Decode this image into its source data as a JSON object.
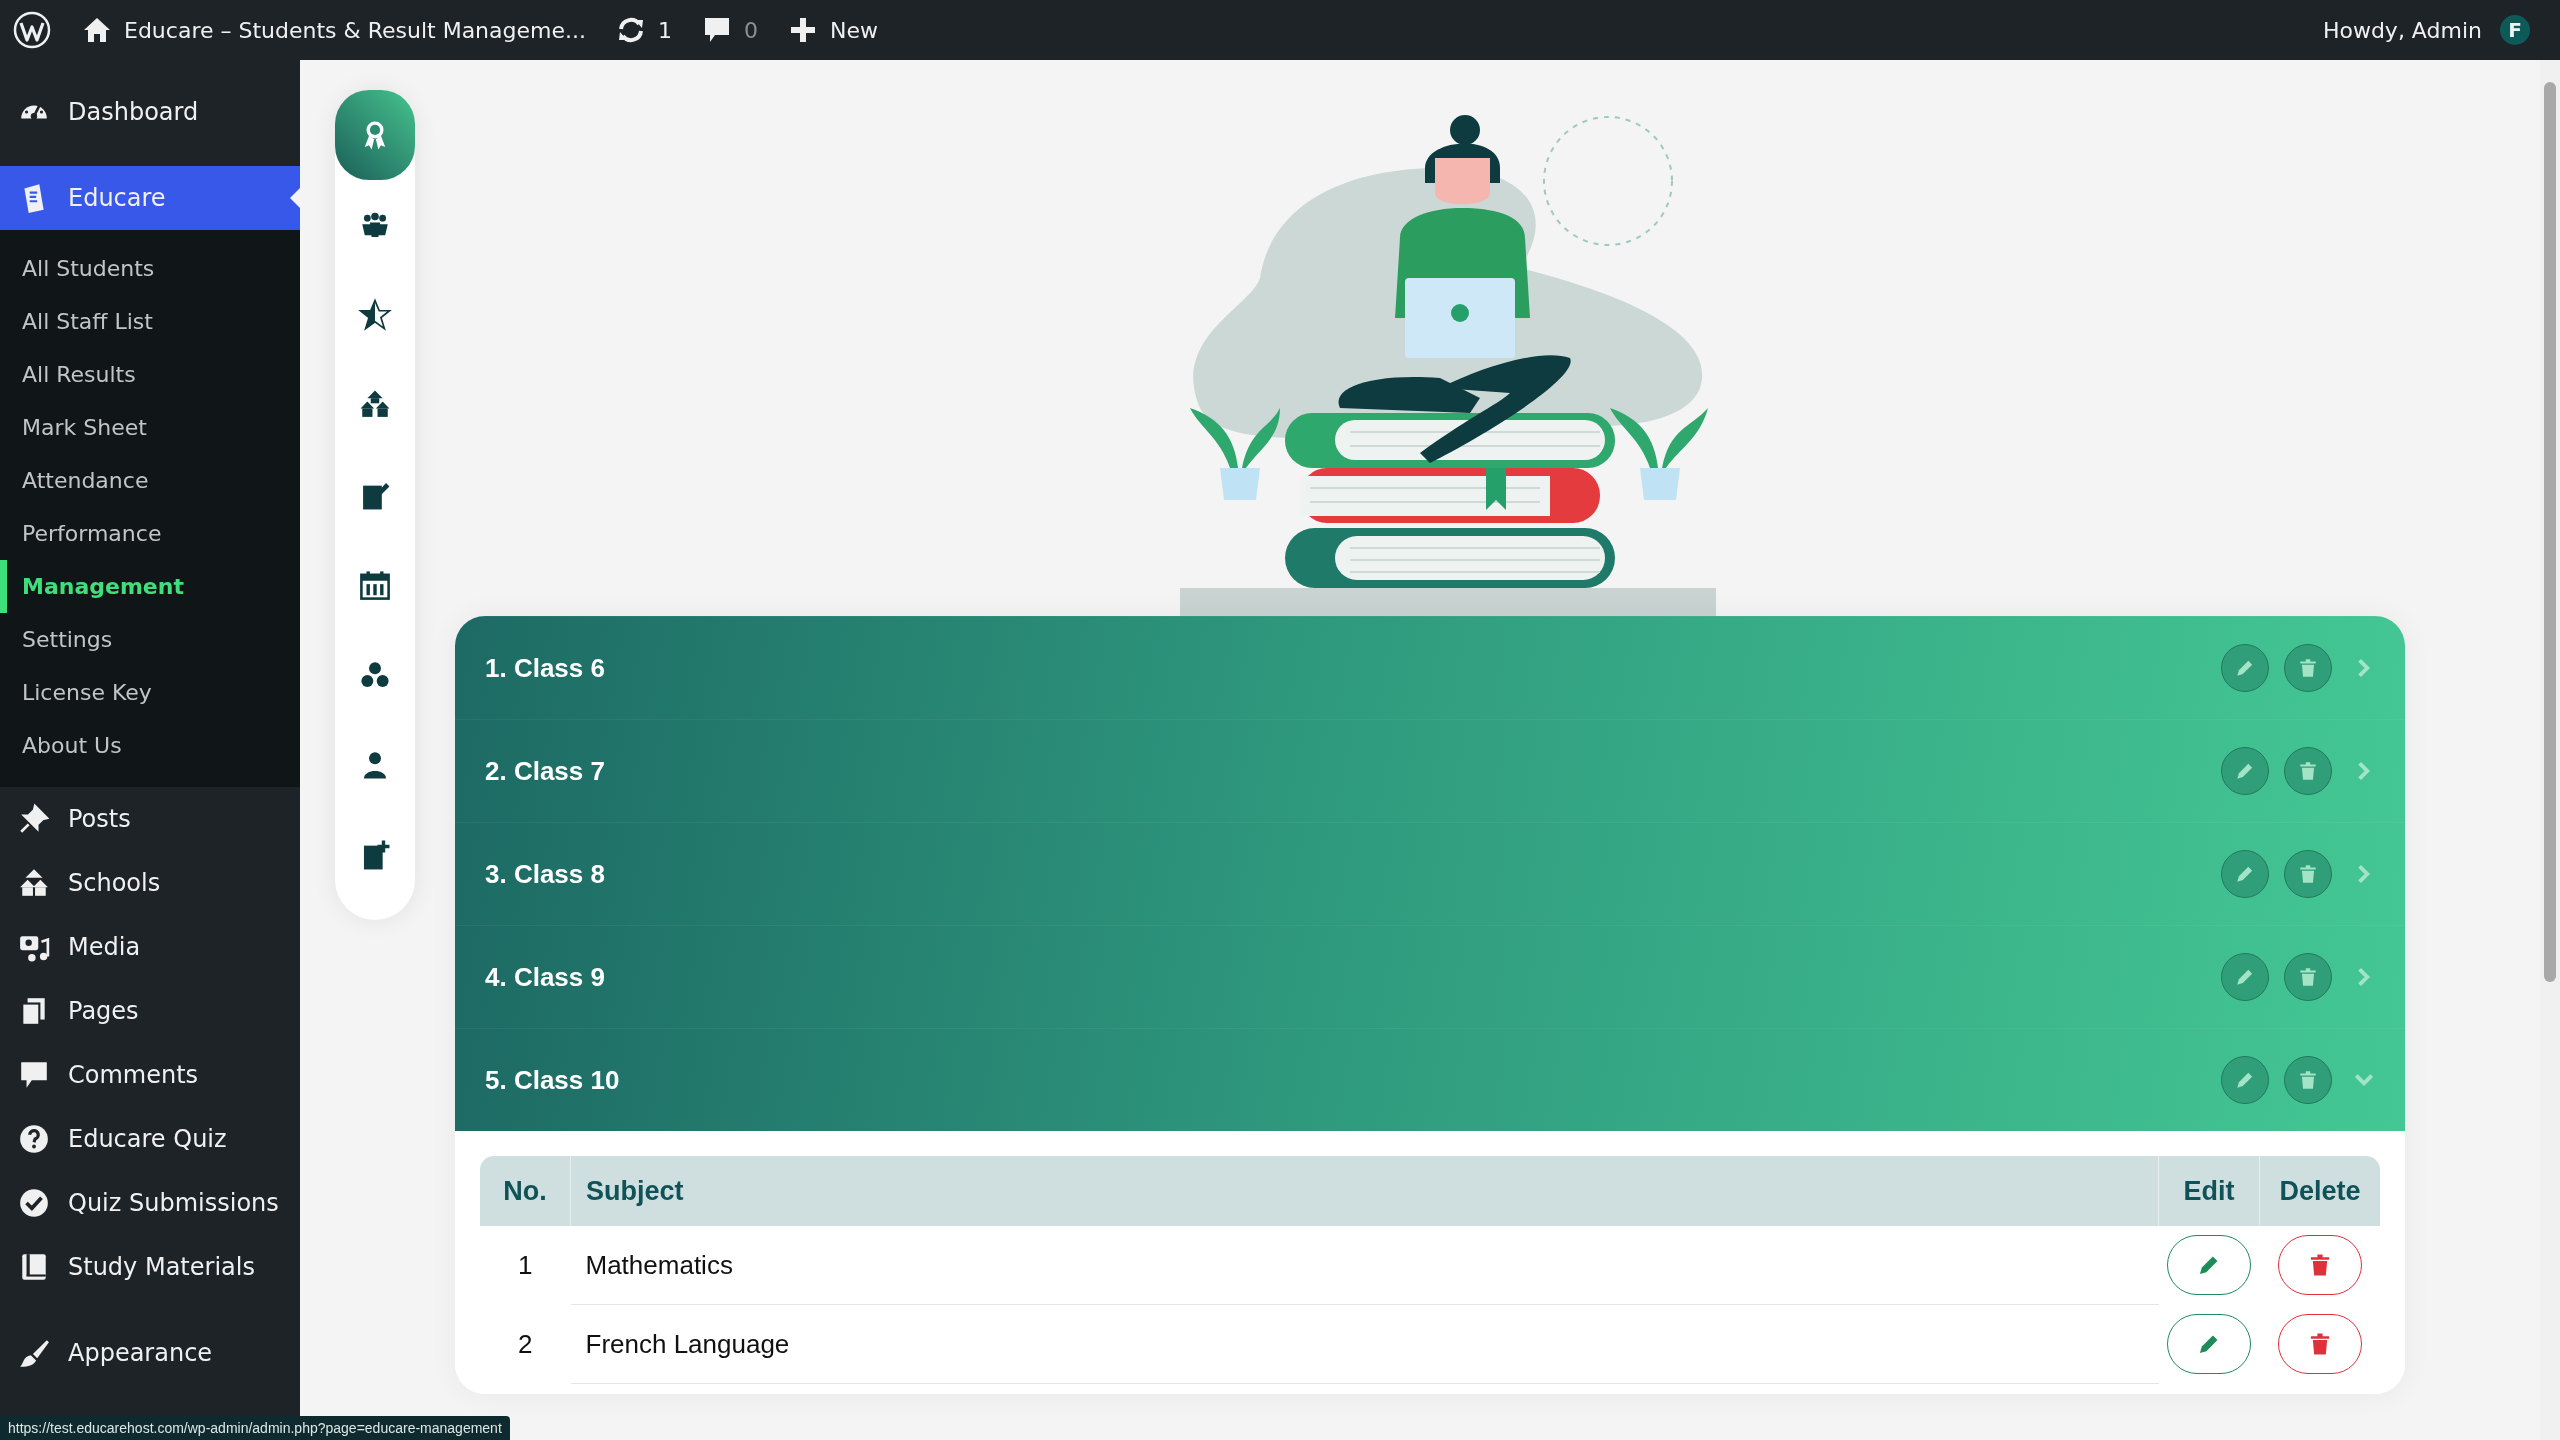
{
  "admin_bar": {
    "site_title": "Educare – Students & Result Manageme...",
    "updates": "1",
    "comments": "0",
    "new_label": "New",
    "greeting": "Howdy, Admin",
    "avatar_letter": "F"
  },
  "sidebar": {
    "groups": [
      [
        {
          "label": "Dashboard",
          "selected": false
        }
      ],
      [
        {
          "label": "Educare",
          "selected": true,
          "children": [
            {
              "label": "All Students",
              "selected": false
            },
            {
              "label": "All Staff List",
              "selected": false
            },
            {
              "label": "All Results",
              "selected": false
            },
            {
              "label": "Mark Sheet",
              "selected": false
            },
            {
              "label": "Attendance",
              "selected": false
            },
            {
              "label": "Performance",
              "selected": false
            },
            {
              "label": "Management",
              "selected": true
            },
            {
              "label": "Settings",
              "selected": false
            },
            {
              "label": "License Key",
              "selected": false
            },
            {
              "label": "About Us",
              "selected": false
            }
          ]
        },
        {
          "label": "Posts",
          "selected": false
        },
        {
          "label": "Schools",
          "selected": false
        },
        {
          "label": "Media",
          "selected": false
        },
        {
          "label": "Pages",
          "selected": false
        },
        {
          "label": "Comments",
          "selected": false
        },
        {
          "label": "Educare Quiz",
          "selected": false
        },
        {
          "label": "Quiz Submissions",
          "selected": false
        },
        {
          "label": "Study Materials",
          "selected": false
        }
      ],
      [
        {
          "label": "Appearance",
          "selected": false
        }
      ]
    ]
  },
  "tool_nav": {
    "items": [
      {
        "selected": true
      },
      {
        "selected": false
      },
      {
        "selected": false
      },
      {
        "selected": false
      },
      {
        "selected": false
      },
      {
        "selected": false
      },
      {
        "selected": false
      },
      {
        "selected": false
      },
      {
        "selected": false
      }
    ]
  },
  "classes": [
    {
      "title": "1. Class 6",
      "expanded": false
    },
    {
      "title": "2. Class 7",
      "expanded": false
    },
    {
      "title": "3. Class 8",
      "expanded": false
    },
    {
      "title": "4. Class 9",
      "expanded": false
    },
    {
      "title": "5. Class 10",
      "expanded": true,
      "subjects": {
        "columns": [
          "No.",
          "Subject",
          "Edit",
          "Delete"
        ],
        "rows": [
          {
            "no": "1",
            "subject": "Mathematics"
          },
          {
            "no": "2",
            "subject": "French Language"
          }
        ]
      }
    }
  ],
  "status_bar": {
    "url": "https://test.educarehost.com/wp-admin/admin.php?page=educare-management"
  }
}
